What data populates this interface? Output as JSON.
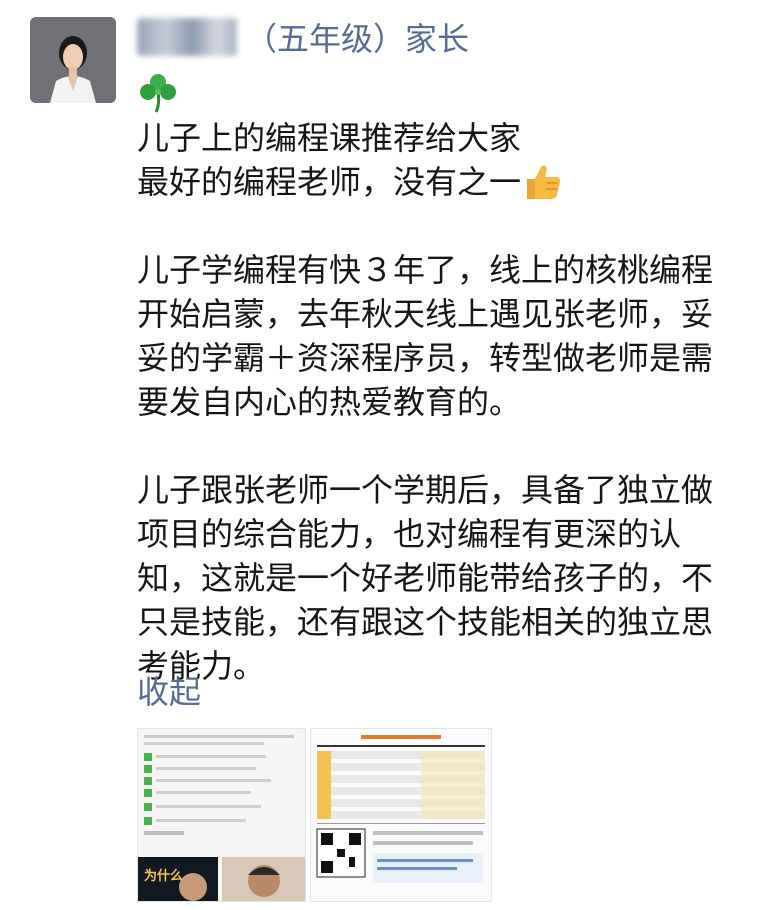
{
  "user": {
    "name_suffix": "（五年级）家长",
    "name_blurred": true
  },
  "post": {
    "paragraphs": [
      [
        "儿子上的编程课推荐给大家",
        "最好的编程老师，没有之一"
      ],
      [
        "儿子学编程有快３年了，线上的核桃编程",
        "开始启蒙，去年秋天线上遇见张老师，妥",
        "妥的学霸＋资深程序员，转型做老师是需",
        "要发自内心的热爱教育的。"
      ],
      [
        "儿子跟张老师一个学期后，具备了独立做",
        "项目的综合能力，也对编程有更深的认",
        "知，这就是一个好老师能带给孩子的，不",
        "只是技能，还有跟这个技能相关的独立思",
        "考能力。"
      ]
    ],
    "emojis": [
      "clover",
      "thumbs-up"
    ]
  },
  "collapse_label": "收起",
  "images": [
    {
      "name": "screenshot-thumbnail",
      "caption": "为什么"
    },
    {
      "name": "schedule-thumbnail"
    }
  ],
  "colors": {
    "link": "#576b95",
    "text": "#161616",
    "checkmark": "#4caf50"
  }
}
